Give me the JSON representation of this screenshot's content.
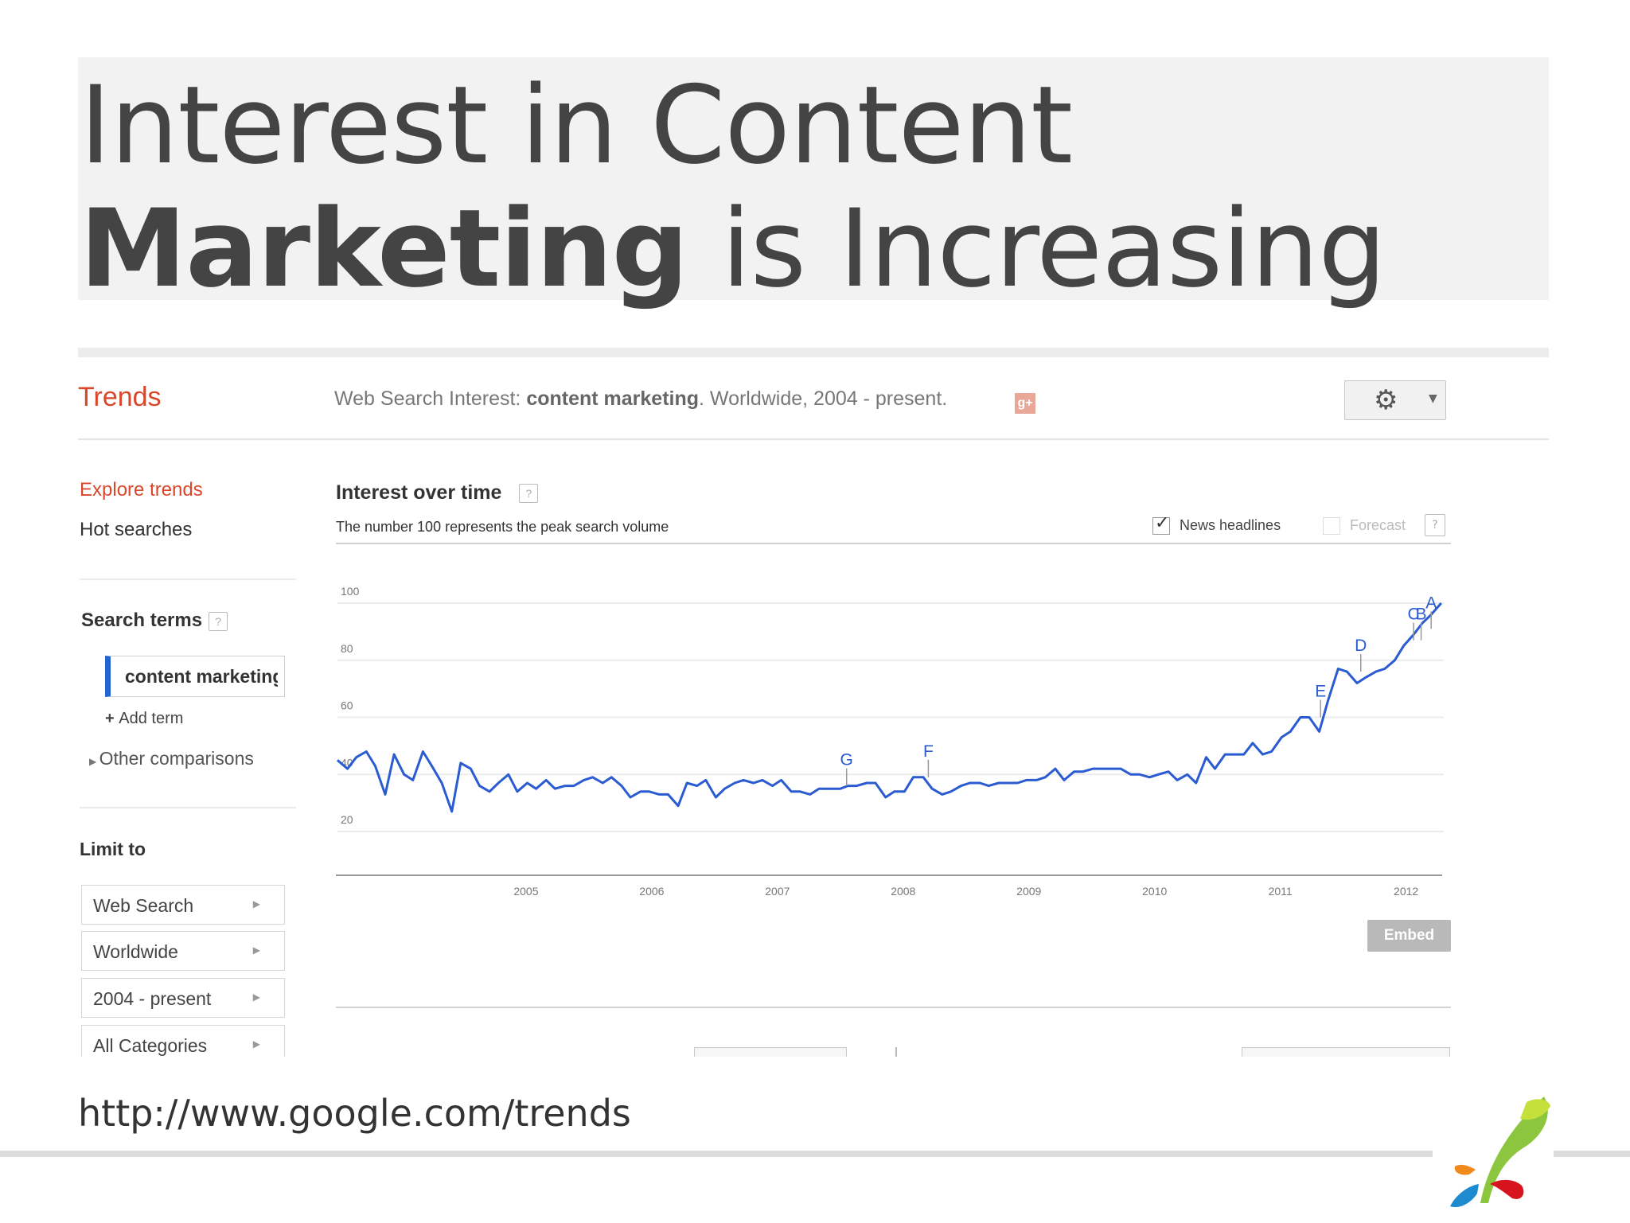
{
  "slide": {
    "title_part1": "Interest in Content ",
    "title_bold": "Marketing",
    "title_part2": " is Increasing",
    "source_url": "http://www.google.com/trends"
  },
  "header": {
    "app_name": "Trends",
    "prefix": "Web Search Interest: ",
    "term": "content marketing",
    "suffix": ". Worldwide, 2004 - present.",
    "gplus_icon": "g+",
    "settings_icon": "gear-icon"
  },
  "sidebar": {
    "explore": "Explore trends",
    "hot": "Hot searches",
    "search_terms_title": "Search terms",
    "term_value": "content marketing",
    "add_term": "Add term",
    "other_comparisons": "Other comparisons",
    "limit_to": "Limit to",
    "filters": [
      "Web Search",
      "Worldwide",
      "2004 - present",
      "All Categories"
    ]
  },
  "panel": {
    "title": "Interest over time",
    "subtitle": "The number 100 represents the peak search volume",
    "news_label": "News headlines",
    "news_checked": true,
    "forecast_label": "Forecast",
    "forecast_checked": false,
    "embed": "Embed"
  },
  "chart_data": {
    "type": "line",
    "title": "",
    "xlabel": "",
    "ylabel": "",
    "yticks": [
      20,
      40,
      60,
      80,
      100
    ],
    "xticks": [
      "2005",
      "2006",
      "2007",
      "2008",
      "2009",
      "2010",
      "2011",
      "2012"
    ],
    "xlim": [
      2004.0,
      2012.8
    ],
    "ylim": [
      0,
      100
    ],
    "color": "#2a5bd1",
    "series": [
      {
        "values": [
          [
            2004.0,
            45
          ],
          [
            2004.08,
            42
          ],
          [
            2004.15,
            46
          ],
          [
            2004.23,
            48
          ],
          [
            2004.3,
            43
          ],
          [
            2004.38,
            33
          ],
          [
            2004.45,
            47
          ],
          [
            2004.53,
            40
          ],
          [
            2004.6,
            38
          ],
          [
            2004.68,
            48
          ],
          [
            2004.75,
            43
          ],
          [
            2004.83,
            37
          ],
          [
            2004.91,
            27
          ],
          [
            2004.98,
            44
          ],
          [
            2005.06,
            42
          ],
          [
            2005.13,
            36
          ],
          [
            2005.21,
            34
          ],
          [
            2005.28,
            37
          ],
          [
            2005.36,
            40
          ],
          [
            2005.43,
            34
          ],
          [
            2005.51,
            37
          ],
          [
            2005.58,
            35
          ],
          [
            2005.66,
            38
          ],
          [
            2005.73,
            35
          ],
          [
            2005.81,
            36
          ],
          [
            2005.88,
            36
          ],
          [
            2005.96,
            38
          ],
          [
            2006.03,
            39
          ],
          [
            2006.11,
            37
          ],
          [
            2006.18,
            39
          ],
          [
            2006.26,
            36
          ],
          [
            2006.33,
            32
          ],
          [
            2006.41,
            34
          ],
          [
            2006.48,
            34
          ],
          [
            2006.56,
            33
          ],
          [
            2006.63,
            33
          ],
          [
            2006.71,
            29
          ],
          [
            2006.78,
            37
          ],
          [
            2006.86,
            36
          ],
          [
            2006.93,
            38
          ],
          [
            2007.01,
            32
          ],
          [
            2007.08,
            35
          ],
          [
            2007.16,
            37
          ],
          [
            2007.23,
            38
          ],
          [
            2007.31,
            37
          ],
          [
            2007.38,
            38
          ],
          [
            2007.46,
            36
          ],
          [
            2007.53,
            38
          ],
          [
            2007.61,
            34
          ],
          [
            2007.68,
            34
          ],
          [
            2007.76,
            33
          ],
          [
            2007.83,
            35
          ],
          [
            2007.91,
            35
          ],
          [
            2008.0,
            35
          ],
          [
            2008.06,
            36
          ],
          [
            2008.13,
            36
          ],
          [
            2008.21,
            37
          ],
          [
            2008.28,
            37
          ],
          [
            2008.36,
            32
          ],
          [
            2008.43,
            34
          ],
          [
            2008.51,
            34
          ],
          [
            2008.58,
            39
          ],
          [
            2008.66,
            39
          ],
          [
            2008.73,
            35
          ],
          [
            2008.81,
            33
          ],
          [
            2008.88,
            34
          ],
          [
            2008.96,
            36
          ],
          [
            2009.03,
            37
          ],
          [
            2009.11,
            37
          ],
          [
            2009.18,
            36
          ],
          [
            2009.26,
            37
          ],
          [
            2009.33,
            37
          ],
          [
            2009.41,
            37
          ],
          [
            2009.48,
            38
          ],
          [
            2009.56,
            38
          ],
          [
            2009.63,
            39
          ],
          [
            2009.71,
            42
          ],
          [
            2009.78,
            38
          ],
          [
            2009.86,
            41
          ],
          [
            2009.93,
            41
          ],
          [
            2010.01,
            42
          ],
          [
            2010.08,
            42
          ],
          [
            2010.16,
            42
          ],
          [
            2010.23,
            42
          ],
          [
            2010.31,
            40
          ],
          [
            2010.38,
            40
          ],
          [
            2010.46,
            39
          ],
          [
            2010.53,
            40
          ],
          [
            2010.61,
            41
          ],
          [
            2010.68,
            38
          ],
          [
            2010.76,
            40
          ],
          [
            2010.83,
            37
          ],
          [
            2010.91,
            46
          ],
          [
            2010.98,
            42
          ],
          [
            2011.06,
            47
          ],
          [
            2011.13,
            47
          ],
          [
            2011.21,
            47
          ],
          [
            2011.28,
            51
          ],
          [
            2011.36,
            47
          ],
          [
            2011.43,
            48
          ],
          [
            2011.51,
            53
          ],
          [
            2011.58,
            55
          ],
          [
            2011.66,
            60
          ],
          [
            2011.73,
            60
          ],
          [
            2011.81,
            55
          ],
          [
            2011.88,
            66
          ],
          [
            2011.96,
            77
          ],
          [
            2012.03,
            76
          ],
          [
            2012.11,
            72
          ],
          [
            2012.18,
            74
          ],
          [
            2012.26,
            76
          ],
          [
            2012.33,
            77
          ],
          [
            2012.41,
            80
          ],
          [
            2012.48,
            85
          ],
          [
            2012.56,
            89
          ],
          [
            2012.63,
            93
          ],
          [
            2012.7,
            96
          ],
          [
            2012.78,
            100
          ]
        ]
      }
    ],
    "annotations": [
      {
        "label": "G",
        "x": 2008.05,
        "y": 36
      },
      {
        "label": "F",
        "x": 2008.7,
        "y": 39
      },
      {
        "label": "E",
        "x": 2011.82,
        "y": 60
      },
      {
        "label": "D",
        "x": 2012.14,
        "y": 76
      },
      {
        "label": "C",
        "x": 2012.56,
        "y": 87
      },
      {
        "label": "B",
        "x": 2012.62,
        "y": 87
      },
      {
        "label": "A",
        "x": 2012.7,
        "y": 91
      }
    ]
  }
}
